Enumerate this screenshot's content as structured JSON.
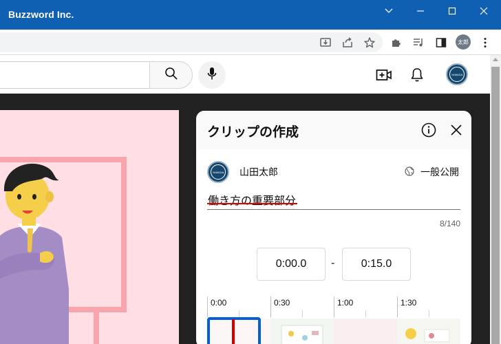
{
  "window": {
    "title": "Buzzword Inc."
  },
  "browser": {
    "profile_label": "太郎",
    "toolbar_icons": [
      "install-icon",
      "share-icon",
      "star-icon",
      "extensions-icon",
      "media-icon",
      "sidepanel-icon",
      "menu-dots-icon"
    ]
  },
  "youtube_header": {
    "search_placeholder": "",
    "icons": [
      "search-icon",
      "microphone-icon",
      "create-video-icon",
      "bell-icon"
    ],
    "avatar_text": "YAMADA"
  },
  "clip_panel": {
    "title": "クリップの作成",
    "channel_name": "山田太郎",
    "visibility_label": "一般公開",
    "clip_title_value": "働き方の重要部分",
    "char_counter": "8/140",
    "start_time": "0:00.0",
    "end_time": "0:15.0",
    "separator": "-",
    "timeline_ticks": [
      "0:00",
      "0:30",
      "1:00",
      "1:30"
    ],
    "avatar_text": "YAMADA"
  },
  "colors": {
    "titlebar": "#0f5fb3",
    "selection": "#065fd4",
    "playhead": "#d40000",
    "video_bg": "#ffdfe3"
  }
}
